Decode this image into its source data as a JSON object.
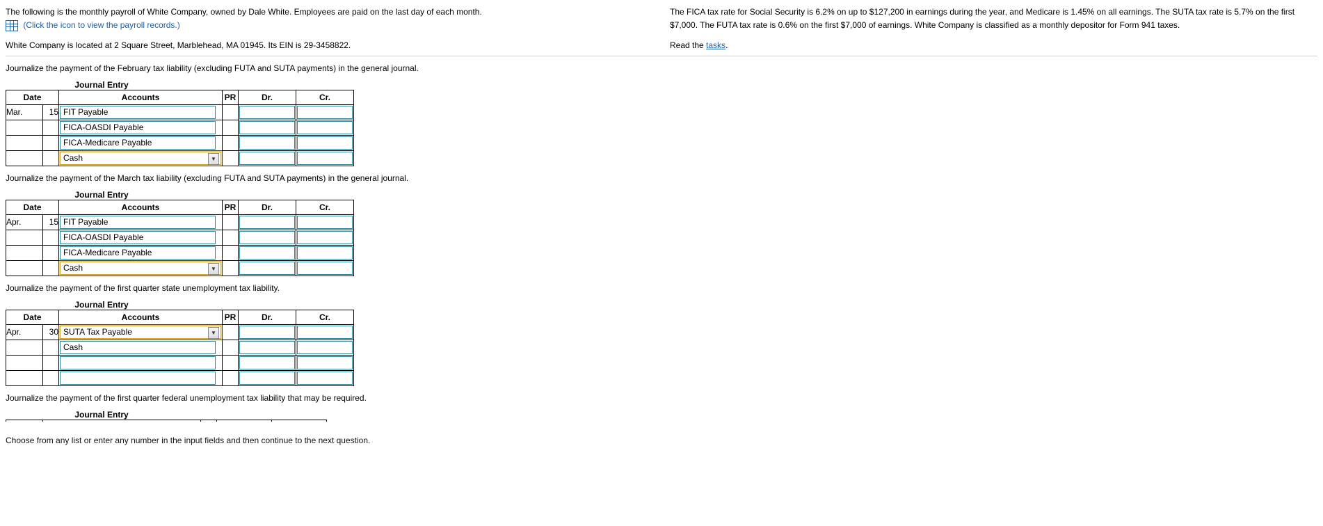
{
  "intro": {
    "line1": "The following is the monthly payroll of White Company, owned by Dale White. Employees are paid on the last day of each month.",
    "icon_link": "(Click the icon to view the payroll records.)",
    "line2": "White Company is located at 2 Square Street, Marblehead, MA 01945. Its EIN is 29-3458822.",
    "right1": "The FICA tax rate for Social Security is 6.2% on up to $127,200 in earnings during the year, and Medicare is 1.45% on all earnings. The SUTA tax rate is 5.7% on the first $7,000. The FUTA tax rate is 0.6% on the first $7,000 of earnings. White Company is classified as a monthly depositor for Form 941 taxes.",
    "read_prefix": "Read the ",
    "tasks_link": "tasks",
    "read_suffix": "."
  },
  "headers": {
    "date": "Date",
    "accounts": "Accounts",
    "pr": "PR",
    "dr": "Dr.",
    "cr": "Cr."
  },
  "je_label": "Journal Entry",
  "je1": {
    "instr": "Journalize the payment of the February tax liability (excluding FUTA and SUTA payments) in the general journal.",
    "month": "Mar.",
    "day": "15",
    "rows": [
      "FIT Payable",
      "FICA-OASDI Payable",
      "FICA-Medicare Payable",
      "Cash"
    ]
  },
  "je2": {
    "instr": "Journalize the payment of the March tax liability (excluding FUTA and SUTA payments) in the general journal.",
    "month": "Apr.",
    "day": "15",
    "rows": [
      "FIT Payable",
      "FICA-OASDI Payable",
      "FICA-Medicare Payable",
      "Cash"
    ]
  },
  "je3": {
    "instr": "Journalize the payment of the first quarter state unemployment tax liability.",
    "month": "Apr.",
    "day": "30",
    "rows": [
      "SUTA Tax Payable",
      "Cash",
      "",
      ""
    ]
  },
  "je4": {
    "instr": "Journalize the payment of the first quarter federal unemployment tax liability that may be required."
  },
  "bottom": "Choose from any list or enter any number in the input fields and then continue to the next question."
}
